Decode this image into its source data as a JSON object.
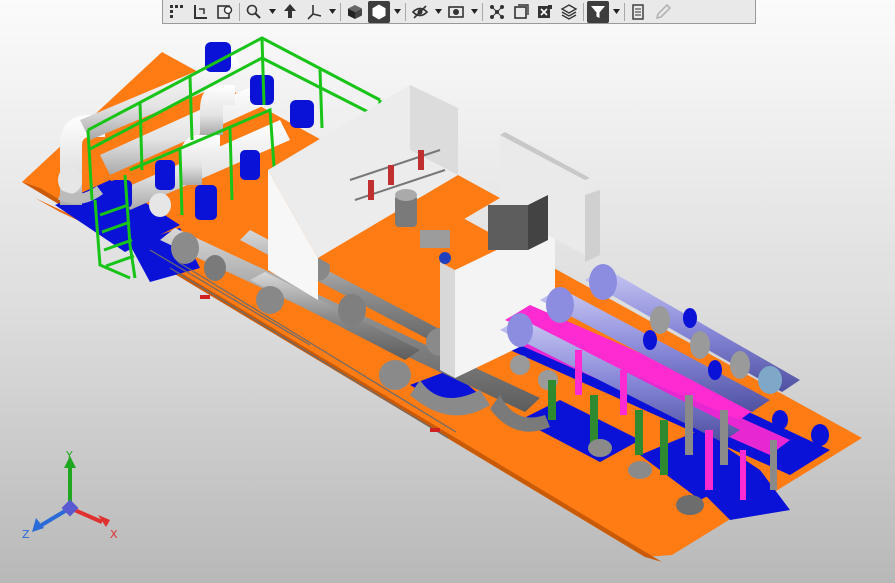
{
  "toolbar": {
    "buttons": [
      {
        "name": "tree-grid-icon",
        "has_dropdown": false
      },
      {
        "name": "orientation-corner-icon",
        "has_dropdown": false
      },
      {
        "name": "zoom-frame-icon",
        "has_dropdown": false
      },
      {
        "name": "zoom-magnifier-icon",
        "has_dropdown": true
      },
      {
        "name": "pan-arrow-icon",
        "has_dropdown": false
      },
      {
        "name": "axis-view-icon",
        "has_dropdown": true
      },
      {
        "name": "shaded-cube-icon",
        "has_dropdown": false
      },
      {
        "name": "hexagon-solid-icon",
        "has_dropdown": true,
        "active": true
      },
      {
        "name": "hidden-view-icon",
        "has_dropdown": true
      },
      {
        "name": "camera-view-icon",
        "has_dropdown": true
      },
      {
        "name": "nodes-icon",
        "has_dropdown": false
      },
      {
        "name": "layer-frame-icon",
        "has_dropdown": false
      },
      {
        "name": "section-view-icon",
        "has_dropdown": false
      },
      {
        "name": "stack-layers-icon",
        "has_dropdown": false
      },
      {
        "name": "filter-icon",
        "has_dropdown": true,
        "active": true
      },
      {
        "name": "properties-grid-icon",
        "has_dropdown": false
      },
      {
        "name": "dropper-icon",
        "has_dropdown": false,
        "disabled": true
      }
    ]
  },
  "triad": {
    "x_label": "X",
    "y_label": "Y",
    "z_label": "Z"
  },
  "colors": {
    "platform": "#ff7b14",
    "base": "#0a12d8",
    "frame": "#19c419",
    "pipe_gray": "#9a9a9a",
    "pipe_white": "#f2f2f2",
    "pipe_magenta": "#ff2bd2",
    "pipe_lavender": "#8c8ce0",
    "pipe_green": "#2f8a2f",
    "cabin_wall": "#f4f4f4",
    "axis_x": "#e03030",
    "axis_y": "#1fa81f",
    "axis_z": "#2a6bd8"
  }
}
